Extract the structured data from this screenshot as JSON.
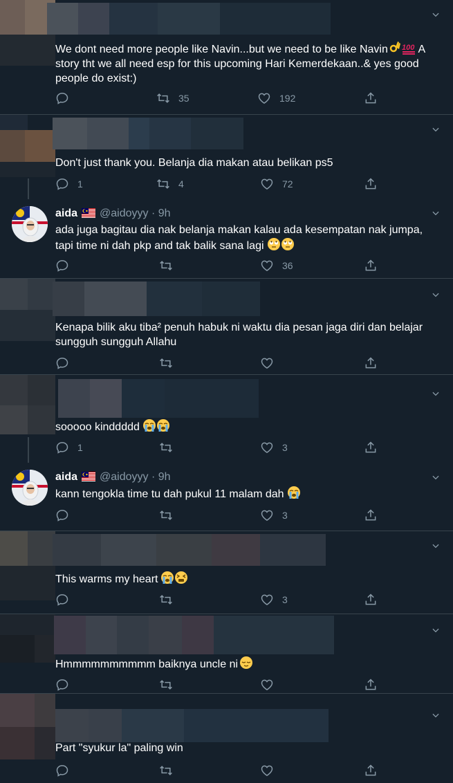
{
  "tweets": [
    {
      "text": "We dont need more people like Navin...but we need to be like Navin",
      "text_tail": "A story tht we all need esp for this upcoming Hari Kemerdekaan..& yes good people do exist:)",
      "emojis": [
        "ok-hand",
        "hundred-points"
      ],
      "replies": "",
      "retweets": "35",
      "likes": "192"
    },
    {
      "text": "Don't just thank you. Belanja dia makan atau belikan ps5",
      "replies": "1",
      "retweets": "4",
      "likes": "72"
    },
    {
      "author": "aida",
      "handle": "@aidoyyy",
      "dot": "·",
      "time": "9h",
      "text": "ada juga bagitau dia nak belanja makan kalau ada kesempatan nak jumpa, tapi time ni dah pkp and tak balik sana lagi",
      "emojis": [
        "rolling-eyes",
        "rolling-eyes"
      ],
      "replies": "",
      "retweets": "",
      "likes": "36"
    },
    {
      "text": "Kenapa bilik aku tiba² penuh habuk ni waktu dia pesan jaga diri dan belajar sungguh sungguh Allahu",
      "replies": "",
      "retweets": "",
      "likes": ""
    },
    {
      "text": "sooooo kinddddd",
      "emojis": [
        "crying",
        "crying"
      ],
      "replies": "1",
      "retweets": "",
      "likes": "3"
    },
    {
      "author": "aida",
      "handle": "@aidoyyy",
      "dot": "·",
      "time": "9h",
      "text": "kann tengokla time tu dah pukul 11 malam dah",
      "emojis": [
        "crying"
      ],
      "replies": "",
      "retweets": "",
      "likes": "3"
    },
    {
      "text": "This warms my heart",
      "emojis": [
        "crying",
        "tired-face"
      ],
      "replies": "",
      "retweets": "",
      "likes": "3"
    },
    {
      "text": "Hmmmmmmmmmm baiknya uncle ni",
      "emojis": [
        "relieved-face"
      ],
      "replies": "",
      "retweets": "",
      "likes": ""
    },
    {
      "text": "Part \"syukur la\" paling win",
      "replies": "",
      "retweets": "",
      "likes": ""
    }
  ],
  "icons": {
    "reply": "reply-icon",
    "retweet": "retweet-icon",
    "like": "like-icon",
    "share": "share-icon",
    "more": "chevron-down-icon",
    "flag": "malaysia-flag-icon"
  },
  "colors": {
    "background": "#15202b",
    "secondary_text": "#8899a6",
    "divider": "#38444d"
  }
}
